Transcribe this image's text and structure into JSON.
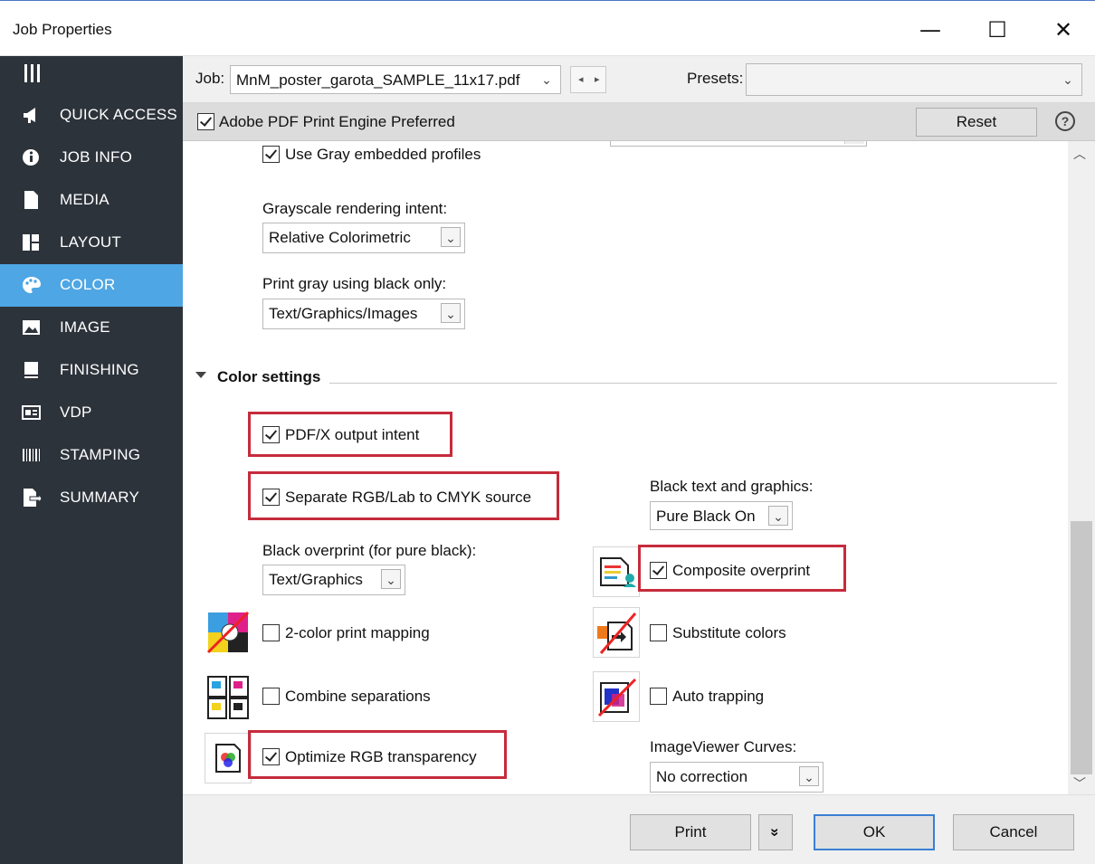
{
  "window": {
    "title": "Job Properties",
    "minimize_glyph": "—",
    "maximize_glyph": "☐",
    "close_glyph": "✕"
  },
  "sidebar": {
    "items": [
      {
        "label": "QUICK ACCESS",
        "icon": "megaphone-icon"
      },
      {
        "label": "JOB INFO",
        "icon": "info-icon"
      },
      {
        "label": "MEDIA",
        "icon": "page-icon"
      },
      {
        "label": "LAYOUT",
        "icon": "layout-icon"
      },
      {
        "label": "COLOR",
        "icon": "palette-icon",
        "active": true
      },
      {
        "label": "IMAGE",
        "icon": "image-icon"
      },
      {
        "label": "FINISHING",
        "icon": "book-icon"
      },
      {
        "label": "VDP",
        "icon": "vdp-icon"
      },
      {
        "label": "STAMPING",
        "icon": "barcode-icon"
      },
      {
        "label": "SUMMARY",
        "icon": "summary-icon"
      }
    ]
  },
  "jobbar": {
    "job_label": "Job:",
    "job_value": "MnM_poster_garota_SAMPLE_11x17.pdf",
    "presets_label": "Presets:",
    "presets_value": ""
  },
  "engine": {
    "label": "Adobe PDF Print Engine Preferred",
    "checked": true,
    "reset_label": "Reset",
    "help_glyph": "?"
  },
  "content": {
    "use_gray_profiles": "Use Gray embedded profiles",
    "grayscale_intent_label": "Grayscale rendering intent:",
    "grayscale_intent_value": "Relative Colorimetric",
    "print_gray_label": "Print gray using black only:",
    "print_gray_value": "Text/Graphics/Images",
    "section_title": "Color settings",
    "pdfx_output_intent": "PDF/X output intent",
    "separate_rgb": "Separate RGB/Lab to CMYK source",
    "black_text_label": "Black text and graphics:",
    "black_text_value": "Pure Black On",
    "black_overprint_label": "Black overprint (for pure black):",
    "black_overprint_value": "Text/Graphics",
    "composite_overprint": "Composite overprint",
    "two_color_mapping": "2-color print mapping",
    "substitute_colors": "Substitute colors",
    "combine_separations": "Combine separations",
    "auto_trapping": "Auto trapping",
    "optimize_rgb": "Optimize RGB transparency",
    "imageviewer_label": "ImageViewer Curves:",
    "imageviewer_value": "No correction",
    "highlight_color": "#c62b3c"
  },
  "footer": {
    "print_label": "Print",
    "more_glyph": "»",
    "ok_label": "OK",
    "cancel_label": "Cancel"
  }
}
